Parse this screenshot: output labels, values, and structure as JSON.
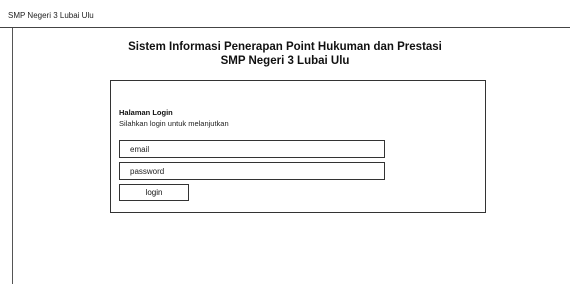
{
  "topbar": {
    "brand": "SMP Negeri 3 Lubai Ulu"
  },
  "header": {
    "title_line1": "Sistem Informasi Penerapan Point Hukuman dan Prestasi",
    "title_line2": "SMP Negeri 3 Lubai Ulu"
  },
  "login": {
    "title": "Halaman Login",
    "subtitle": "Silahkan login untuk melanjutkan",
    "email_placeholder": "email",
    "password_placeholder": "password",
    "button_label": "login"
  }
}
